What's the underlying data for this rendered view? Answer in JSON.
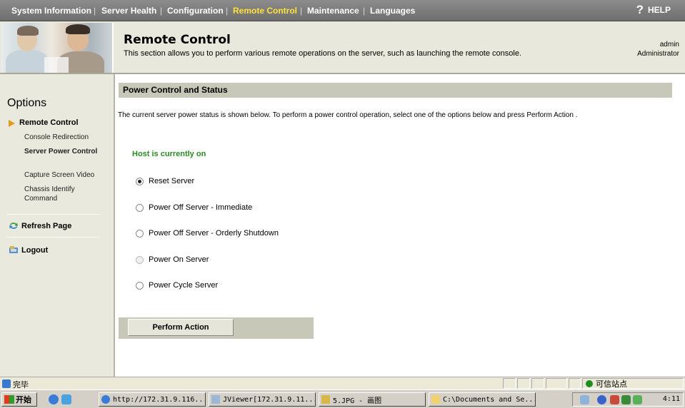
{
  "nav": {
    "tabs": [
      {
        "label": "System Information"
      },
      {
        "label": "Server Health"
      },
      {
        "label": "Configuration"
      },
      {
        "label": "Remote Control"
      },
      {
        "label": "Maintenance"
      },
      {
        "label": "Languages"
      }
    ],
    "active_tab": "Remote Control",
    "help_label": "HELP"
  },
  "header": {
    "title": "Remote Control",
    "description": "This section allows you to perform various remote operations on the server, such as launching the remote console.",
    "user": "admin",
    "role": "Administrator"
  },
  "sidebar": {
    "title": "Options",
    "section": "Remote Control",
    "items": [
      {
        "label": "Console Redirection"
      },
      {
        "label": "Server Power Control"
      },
      {
        "label": "Capture Screen Video"
      },
      {
        "label": "Chassis Identify Command"
      }
    ],
    "active_item": "Server Power Control",
    "refresh_label": "Refresh Page",
    "logout_label": "Logout"
  },
  "main": {
    "section_title": "Power Control and Status",
    "description": "The current server power status is shown below. To perform a power control operation, select one of the options below and press Perform Action .",
    "host_status": "Host is currently on",
    "options": [
      {
        "label": "Reset Server"
      },
      {
        "label": "Power Off Server - Immediate"
      },
      {
        "label": "Power Off Server - Orderly Shutdown"
      },
      {
        "label": "Power On Server"
      },
      {
        "label": "Power Cycle Server"
      }
    ],
    "selected_option": "Reset Server",
    "disabled_option": "Power On Server",
    "action_label": "Perform Action"
  },
  "statusbar": {
    "text": "完毕",
    "zone": "可信站点"
  },
  "taskbar": {
    "start_label": "开始",
    "tasks": [
      {
        "label": "http://172.31.9.116..."
      },
      {
        "label": "JViewer[172.31.9.11..."
      },
      {
        "label": "5.JPG - 画图"
      },
      {
        "label": "C:\\Documents and Se..."
      }
    ],
    "clock": "4:11"
  },
  "colors": {
    "nav_bg": "#7c7c7c",
    "nav_active": "#ffe23a",
    "panel_bg": "#e9e9dd",
    "section_bar": "#c8c8b8",
    "status_green": "#2a8a24",
    "arrow_orange": "#e39a1f"
  }
}
